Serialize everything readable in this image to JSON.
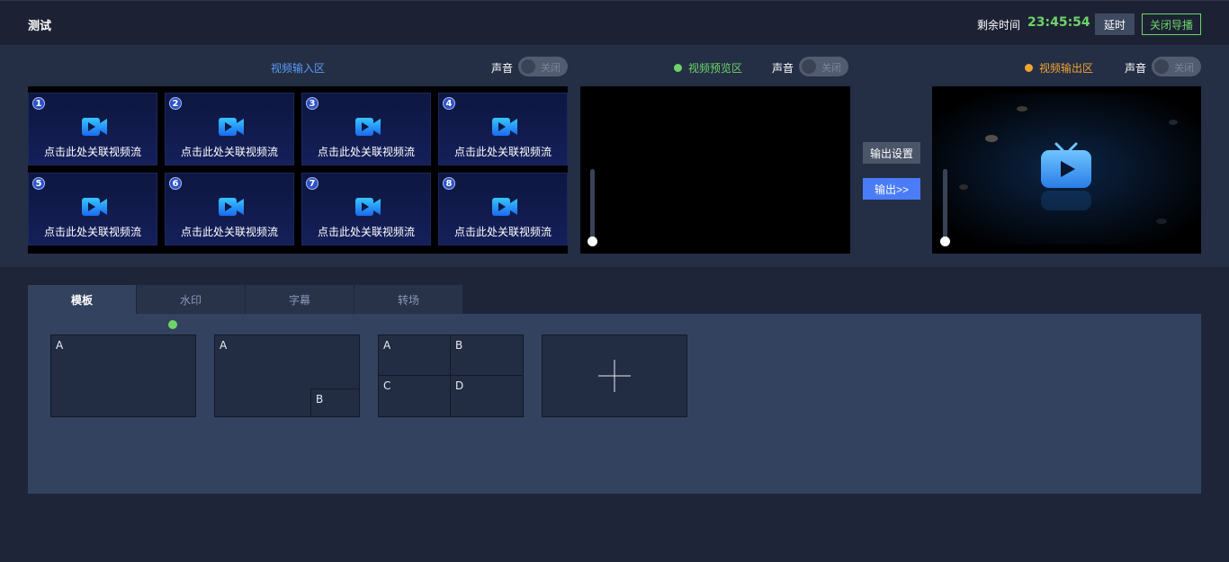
{
  "header": {
    "title": "测试",
    "remain_label": "剩余时间",
    "remain_time": "23:45:54",
    "delay_button": "延时",
    "close_guide_button": "关闭导播",
    "time_color": "#6fd36a"
  },
  "input_area": {
    "label": "视频输入区",
    "label_color": "#5b9bf5",
    "sound_label": "声音",
    "sound_toggle": "关闭",
    "cells": [
      {
        "num": "1",
        "label": "点击此处关联视频流"
      },
      {
        "num": "2",
        "label": "点击此处关联视频流"
      },
      {
        "num": "3",
        "label": "点击此处关联视频流"
      },
      {
        "num": "4",
        "label": "点击此处关联视频流"
      },
      {
        "num": "5",
        "label": "点击此处关联视频流"
      },
      {
        "num": "6",
        "label": "点击此处关联视频流"
      },
      {
        "num": "7",
        "label": "点击此处关联视频流"
      },
      {
        "num": "8",
        "label": "点击此处关联视频流"
      }
    ]
  },
  "preview_area": {
    "label": "视频预览区",
    "label_color": "#6fd36a",
    "sound_label": "声音",
    "sound_toggle": "关闭"
  },
  "output_controls": {
    "settings_button": "输出设置",
    "output_button": "输出>>"
  },
  "output_area": {
    "label": "视频输出区",
    "label_color": "#f0a531",
    "sound_label": "声音",
    "sound_toggle": "关闭"
  },
  "tabs": [
    {
      "label": "模板",
      "active": true
    },
    {
      "label": "水印",
      "active": false
    },
    {
      "label": "字幕",
      "active": false
    },
    {
      "label": "转场",
      "active": false
    }
  ],
  "templates": [
    {
      "labels": [
        "A"
      ]
    },
    {
      "labels": [
        "A",
        "B"
      ]
    },
    {
      "labels": [
        "A",
        "B",
        "C",
        "D"
      ]
    },
    {
      "labels": []
    }
  ]
}
